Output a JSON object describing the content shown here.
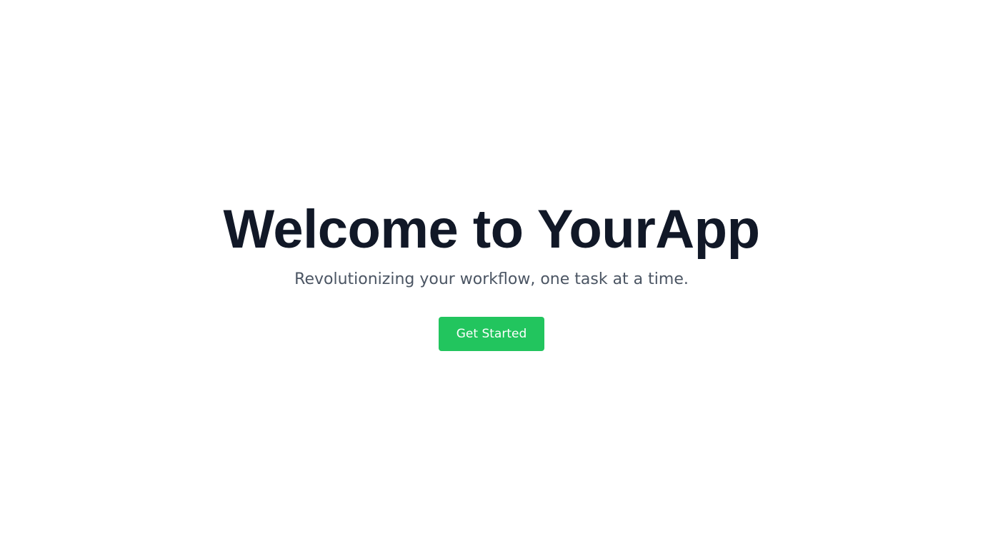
{
  "hero": {
    "title": "Welcome to YourApp",
    "subtitle": "Revolutionizing your workflow, one task at a time.",
    "cta_label": "Get Started"
  },
  "colors": {
    "background": "#ffffff",
    "title": "#111827",
    "subtitle": "#4b5563",
    "cta_background": "#22c55e",
    "cta_text": "#ffffff"
  }
}
